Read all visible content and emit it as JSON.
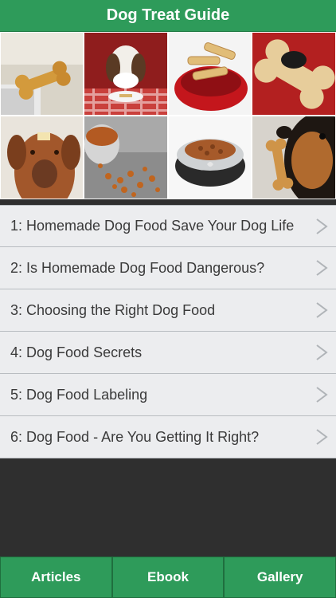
{
  "header": {
    "title": "Dog Treat Guide"
  },
  "gallery": {
    "images": [
      "bone-toaster-photo",
      "spaniel-at-table-photo",
      "bone-treats-bowl-photo",
      "bone-cookie-photo",
      "dog-treat-on-nose-photo",
      "spilled-kibble-photo",
      "kibble-bowl-photo",
      "dog-with-bone-photo"
    ]
  },
  "articles": [
    {
      "label": "1: Homemade Dog Food Save Your Dog Life"
    },
    {
      "label": "2: Is Homemade Dog Food Dangerous?"
    },
    {
      "label": "3: Choosing the Right Dog Food"
    },
    {
      "label": "4: Dog Food Secrets"
    },
    {
      "label": "5: Dog Food Labeling"
    },
    {
      "label": "6: Dog Food - Are You Getting It Right?"
    }
  ],
  "tabs": [
    {
      "label": "Articles"
    },
    {
      "label": "Ebook"
    },
    {
      "label": "Gallery"
    }
  ],
  "colors": {
    "accent": "#2e9b5a",
    "list_bg": "#ecedef",
    "dark_bg": "#2f2f2f"
  }
}
